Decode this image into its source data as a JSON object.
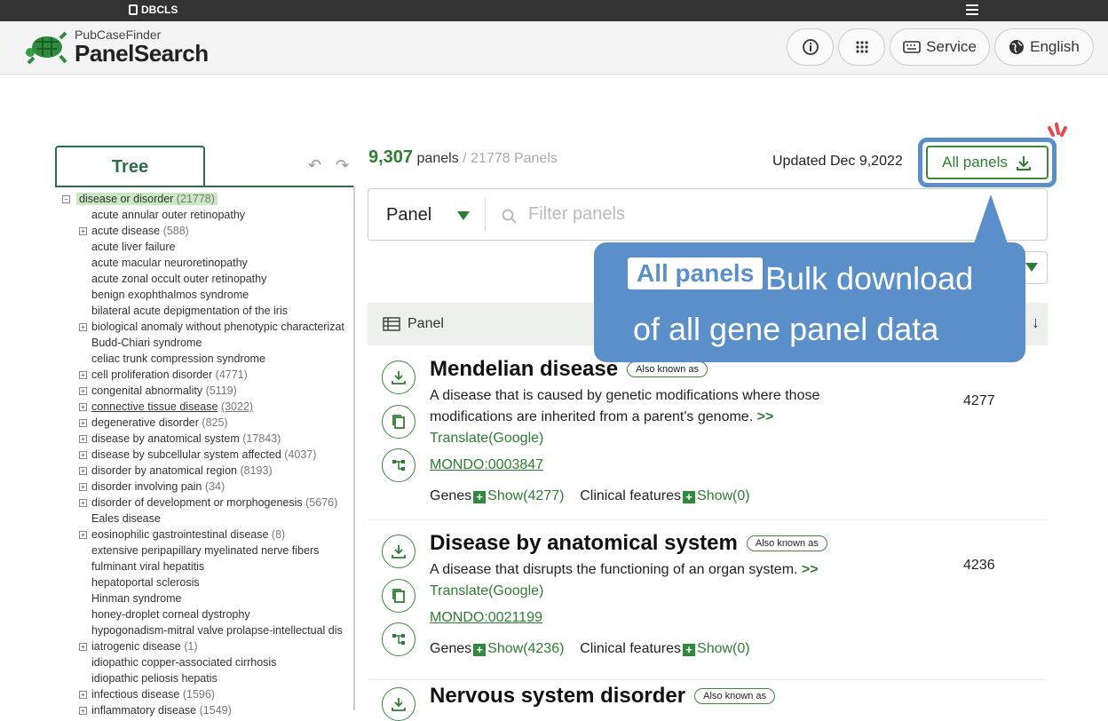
{
  "topbar": {
    "org": "DBCLS"
  },
  "header": {
    "brand_sub": "PubCaseFinder",
    "brand_main": "PanelSearch",
    "service": "Service",
    "language": "English"
  },
  "tree": {
    "tab": "Tree",
    "root": {
      "label": "disease or disorder",
      "count": "(21778)"
    },
    "items": [
      {
        "label": "acute annular outer retinopathy",
        "count": "",
        "exp": false
      },
      {
        "label": "acute disease",
        "count": "(588)",
        "exp": true
      },
      {
        "label": "acute liver failure",
        "count": "",
        "exp": false
      },
      {
        "label": "acute macular neuroretinopathy",
        "count": "",
        "exp": false
      },
      {
        "label": "acute zonal occult outer retinopathy",
        "count": "",
        "exp": false
      },
      {
        "label": "benign exophthalmos syndrome",
        "count": "",
        "exp": false
      },
      {
        "label": "bilateral acute depigmentation of the iris",
        "count": "",
        "exp": false
      },
      {
        "label": "biological anomaly without phenotypic characterizat",
        "count": "",
        "exp": true
      },
      {
        "label": "Budd-Chiari syndrome",
        "count": "",
        "exp": false
      },
      {
        "label": "celiac trunk compression syndrome",
        "count": "",
        "exp": false
      },
      {
        "label": "cell proliferation disorder",
        "count": "(4771)",
        "exp": true
      },
      {
        "label": "congenital abnormality",
        "count": "(5119)",
        "exp": true
      },
      {
        "label": "connective tissue disease",
        "count": "(3022)",
        "exp": true,
        "ul": true
      },
      {
        "label": "degenerative disorder",
        "count": "(825)",
        "exp": true
      },
      {
        "label": "disease by anatomical system",
        "count": "(17843)",
        "exp": true
      },
      {
        "label": "disease by subcellular system affected",
        "count": "(4037)",
        "exp": true
      },
      {
        "label": "disorder by anatomical region",
        "count": "(8193)",
        "exp": true
      },
      {
        "label": "disorder involving pain",
        "count": "(34)",
        "exp": true
      },
      {
        "label": "disorder of development or morphogenesis",
        "count": "(5676)",
        "exp": true
      },
      {
        "label": "Eales disease",
        "count": "",
        "exp": false
      },
      {
        "label": "eosinophilic gastrointestinal disease",
        "count": "(8)",
        "exp": true
      },
      {
        "label": "extensive peripapillary myelinated nerve fibers",
        "count": "",
        "exp": false
      },
      {
        "label": "fulminant viral hepatitis",
        "count": "",
        "exp": false
      },
      {
        "label": "hepatoportal sclerosis",
        "count": "",
        "exp": false
      },
      {
        "label": "Hinman syndrome",
        "count": "",
        "exp": false
      },
      {
        "label": "honey-droplet corneal dystrophy",
        "count": "",
        "exp": false
      },
      {
        "label": "hypogonadism-mitral valve prolapse-intellectual dis",
        "count": "",
        "exp": false
      },
      {
        "label": "iatrogenic disease",
        "count": "(1)",
        "exp": true
      },
      {
        "label": "idiopathic copper-associated cirrhosis",
        "count": "",
        "exp": false
      },
      {
        "label": "idiopathic peliosis hepatis",
        "count": "",
        "exp": false
      },
      {
        "label": "infectious disease",
        "count": "(1596)",
        "exp": true
      },
      {
        "label": "inflammatory disease",
        "count": "(1549)",
        "exp": true
      }
    ]
  },
  "results": {
    "count": "9,307",
    "unit": "panels",
    "total": "/ 21778 Panels",
    "updated": "Updated Dec 9,2022",
    "all_panels": "All panels"
  },
  "filter": {
    "select": "Panel",
    "placeholder": "Filter panels"
  },
  "table": {
    "header": "Panel",
    "arrow": "↓"
  },
  "panels": [
    {
      "title": "Mendelian disease",
      "aka": "Also known as",
      "desc": "A disease that is caused by genetic modifications where those modifications are inherited from a parent's genome.",
      "more": ">>",
      "translate": "Translate(Google)",
      "mondo": "MONDO:0003847",
      "genes_label": "Genes",
      "genes_show": "Show(4277)",
      "cf_label": "Clinical features",
      "cf_show": "Show(0)",
      "num": "4277"
    },
    {
      "title": "Disease by anatomical system",
      "aka": "Also known as",
      "desc": "A disease that disrupts the functioning of an organ system.",
      "more": ">>",
      "translate": "Translate(Google)",
      "mondo": "MONDO:0021199",
      "genes_label": "Genes",
      "genes_show": "Show(4236)",
      "cf_label": "Clinical features",
      "cf_show": "Show(0)",
      "num": "4236"
    },
    {
      "title": "Nervous system disorder",
      "aka": "Also known as"
    }
  ],
  "callout": {
    "badge": "All panels",
    "line1": "Bulk download",
    "line2": "of all gene panel data"
  },
  "colors": {
    "accent": "#2e7d32",
    "callout": "#5b8fc9"
  }
}
